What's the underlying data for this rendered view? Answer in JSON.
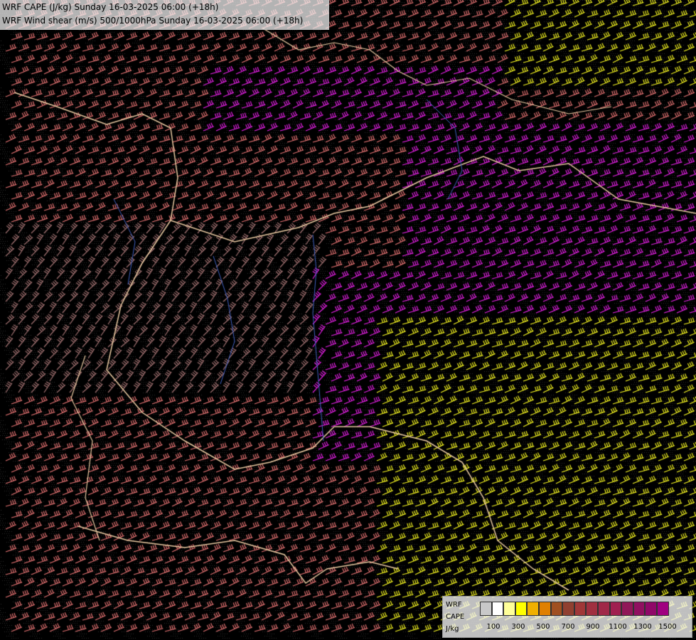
{
  "header": {
    "title_line1": "WRF CAPE (J/kg) Sunday 16-03-2025 06:00 (+18h)",
    "title_line2": "WRF Wind shear (m/s) 500/1000hPa Sunday 16-03-2025 06:00 (+18h)"
  },
  "legend": {
    "model": "WRF",
    "field": "CAPE",
    "unit": "J/kg",
    "colors": [
      "#c8c8c8",
      "#ffffff",
      "#ffff99",
      "#ffff00",
      "#f0b000",
      "#e08000",
      "#a05020",
      "#904030",
      "#a03838",
      "#a03040",
      "#a02848",
      "#a02050",
      "#901858",
      "#901060",
      "#900868",
      "#a00080"
    ],
    "ticks": [
      "100",
      "300",
      "500",
      "700",
      "900",
      "1100",
      "1300",
      "1500"
    ]
  },
  "map_layers": {
    "barb_colors": {
      "low": "#a07070",
      "mid": "#e07070",
      "high": "#e020e0",
      "very_high": "#f0f020"
    },
    "border_color": "#e8c8a0",
    "river_color": "#4060c0",
    "background": "#000000"
  }
}
